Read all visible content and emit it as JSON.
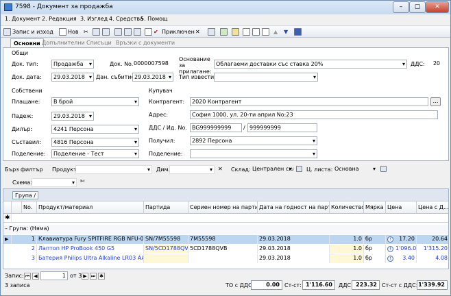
{
  "window": {
    "title": "7598 - Документ за продажба",
    "min": "–",
    "max": "▢",
    "close": "✕"
  },
  "menu": [
    "1. Документ",
    "2. Редакция",
    "3. Изглед",
    "4. Средства",
    "5. Помощ"
  ],
  "toolbar": {
    "save_exit": "Запис и изход",
    "new": "Нов",
    "finish": "Приключен"
  },
  "tabs": [
    "Основни",
    "Допълнителни",
    "Списъци",
    "Връзки с документи"
  ],
  "general": {
    "heading": "Общи",
    "doc_type_label": "Док. тип:",
    "doc_type": "Продажба",
    "doc_no_label": "Док. No.",
    "doc_no": "0000007598",
    "basis_label": "Основание за прилагане:",
    "basis": "Облагаеми доставки със ставка 20%",
    "vat_label": "ДДС:",
    "vat": "20",
    "doc_date_label": "Док. дата:",
    "doc_date": "29.03.2018",
    "event_date_label": "Дан. събитие:",
    "event_date": "29.03.2018",
    "notice_label": "Тип известие:",
    "notice": ""
  },
  "own": {
    "heading": "Собствени",
    "payment_label": "Плащане:",
    "payment": "В брой",
    "due_label": "Падеж:",
    "due": "29.03.2018",
    "dealer_label": "Дилър:",
    "dealer": "4241 Персона",
    "compiler_label": "Съставил:",
    "compiler": "4816 Персона",
    "division_label": "Поделение:",
    "division": "Поделение - Тест"
  },
  "buyer": {
    "heading": "Купувач",
    "contractor_label": "Контрагент:",
    "contractor": "2020 Контрагент",
    "address_label": "Адрес:",
    "address": "София 1000, ул. 20-ти април No:23",
    "vatid_label": "ДДС / Ид. No.",
    "vatno": "BG999999999",
    "idno": "999999999",
    "receiver_label": "Получил:",
    "receiver": "2892 Персона",
    "division_label": "Поделение:",
    "division": ""
  },
  "filter": {
    "quick": "Бърз филтър",
    "product_label": "Продукт:",
    "dim_label": "Дим.",
    "warehouse_label": "Склад:",
    "warehouse": "Централен скл",
    "price_list_label": "Ц. листа:",
    "price_list": "Основна",
    "schema_label": "Схема:"
  },
  "grid": {
    "group_chip": "Група /",
    "columns": [
      "No.",
      "Продукт/материал",
      "Партида",
      "Сериен номер на партида",
      "Дата на годност на партида",
      "Количество",
      "Мярка",
      "Цена",
      "Цена с Д..."
    ],
    "group_row": "Група: (Няма)",
    "rows": [
      {
        "no": "1",
        "product": "Клавиатура Fury SPITFIRE RGB NFU-0868",
        "batch": "SN/7M55598",
        "serial": "7M55598",
        "expiry": "29.03.2018",
        "qty": "1.0",
        "unit": "бр",
        "price": "17.20",
        "price_vat": "20.64"
      },
      {
        "no": "2",
        "product": "Лаптоп HP ProBook 450 G5",
        "batch": "SN/5CD1788QVB",
        "serial": "5CD1788QVB",
        "expiry": "29.03.2018",
        "qty": "1.0",
        "unit": "бр",
        "price": "1'096.00",
        "price_vat": "1'315.20"
      },
      {
        "no": "3",
        "product": "Батерия Philips Ultra Alkaline LR03 AAA ...",
        "batch": "",
        "serial": "",
        "expiry": "29.03.2018",
        "qty": "1.0",
        "unit": "бр",
        "price": "3.40",
        "price_vat": "4.08"
      }
    ]
  },
  "status": {
    "record_label": "Запис:",
    "record": "1",
    "of": "от 3",
    "count": "3 записа",
    "to_vat_label": "ТО с ДДС:",
    "to_vat": "0.00",
    "st_label": "Ст-ст:",
    "st": "1'116.60",
    "vat_label": "ДДС:",
    "vat": "223.32",
    "st_vat_label": "Ст-ст с ДДС:",
    "st_vat": "1'339.92"
  },
  "colors": {
    "selected_row": "#bcd6f2",
    "blue_text": "#1f3fd0",
    "highlight_cell": "#fff8d6"
  }
}
